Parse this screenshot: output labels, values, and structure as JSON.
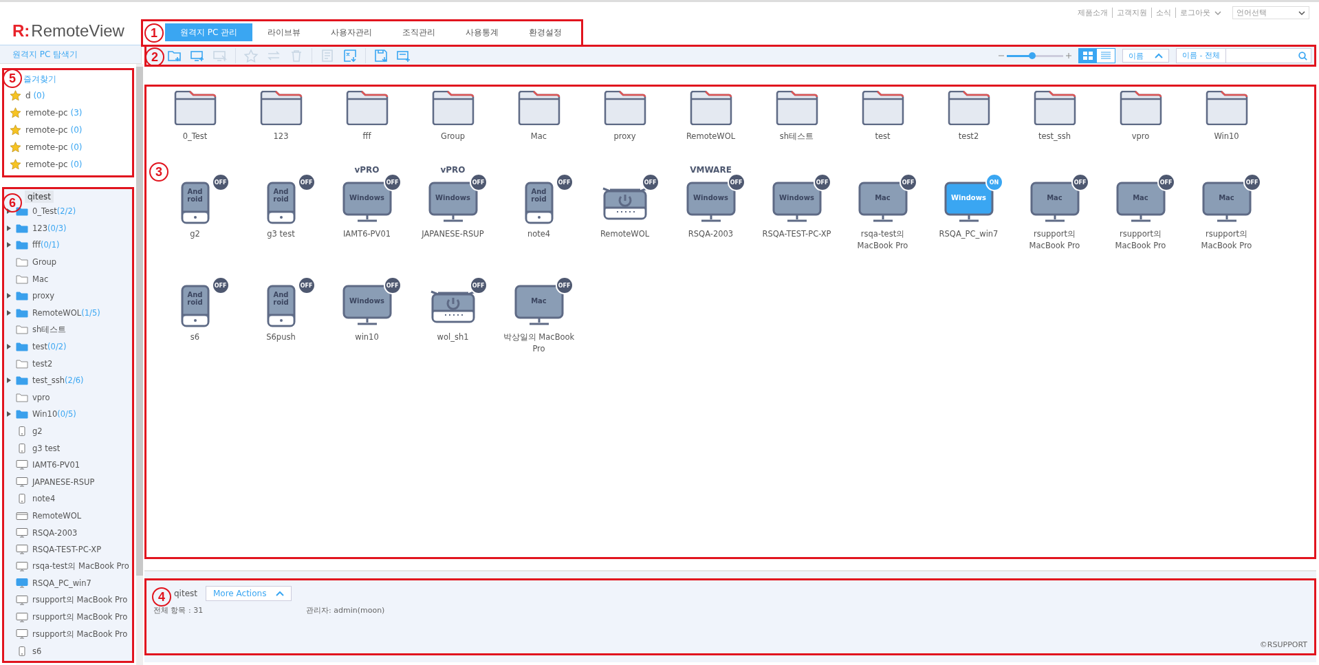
{
  "top_links": [
    "제품소개",
    "고객지원",
    "소식",
    "로그아웃"
  ],
  "language_select": {
    "value": "언어선택"
  },
  "logo": {
    "mark": "R:",
    "name": "RemoteView"
  },
  "tabs": {
    "callout": "1",
    "items": [
      {
        "label": "원격지 PC 관리",
        "selected": true
      },
      {
        "label": "라이브뷰",
        "selected": false
      },
      {
        "label": "사용자관리",
        "selected": false
      },
      {
        "label": "조직관리",
        "selected": false
      },
      {
        "label": "사용통계",
        "selected": false
      },
      {
        "label": "환경설정",
        "selected": false
      }
    ]
  },
  "toolbar": {
    "callout": "2",
    "tools": [
      {
        "kind": "folder-add",
        "disabled": false
      },
      {
        "kind": "monitor-add",
        "disabled": false
      },
      {
        "kind": "monitor-select",
        "disabled": true
      },
      {
        "kind": "star",
        "disabled": true
      },
      {
        "kind": "swap",
        "disabled": true
      },
      {
        "kind": "trash",
        "disabled": true
      },
      {
        "kind": "note",
        "disabled": true
      },
      {
        "kind": "excel",
        "disabled": false
      },
      {
        "kind": "save",
        "disabled": false
      },
      {
        "kind": "wol-add",
        "disabled": false
      }
    ],
    "zoom": {
      "level": 0.45
    },
    "views": [
      {
        "kind": "grid",
        "selected": true
      },
      {
        "kind": "list",
        "selected": false
      }
    ],
    "sort": {
      "label": "이름"
    },
    "search": {
      "scope": "이름 - 전체"
    }
  },
  "sidebar": {
    "title": "원격지 PC 탐색기",
    "favorites": {
      "callout": "5",
      "title": "즐겨찾기",
      "items": [
        {
          "name": "d",
          "count": "(0)"
        },
        {
          "name": "remote-pc",
          "count": "(3)"
        },
        {
          "name": "remote-pc",
          "count": "(0)"
        },
        {
          "name": "remote-pc",
          "count": "(0)"
        },
        {
          "name": "remote-pc",
          "count": "(0)"
        }
      ]
    },
    "tree": {
      "callout": "6",
      "root": "qitest",
      "children": [
        {
          "kind": "group",
          "has_children": true,
          "name": "0_Test",
          "count": "(2/2)"
        },
        {
          "kind": "group",
          "has_children": true,
          "name": "123",
          "count": "(0/3)"
        },
        {
          "kind": "group",
          "has_children": true,
          "name": "fff",
          "count": "(0/1)"
        },
        {
          "kind": "group",
          "has_children": false,
          "name": "Group"
        },
        {
          "kind": "group",
          "has_children": false,
          "name": "Mac"
        },
        {
          "kind": "group",
          "has_children": true,
          "name": "proxy"
        },
        {
          "kind": "group",
          "has_children": true,
          "name": "RemoteWOL",
          "count": "(1/5)"
        },
        {
          "kind": "group",
          "has_children": false,
          "name": "sh테스트"
        },
        {
          "kind": "group",
          "has_children": true,
          "name": "test",
          "count": "(0/2)"
        },
        {
          "kind": "group",
          "has_children": false,
          "name": "test2"
        },
        {
          "kind": "group",
          "has_children": true,
          "name": "test_ssh",
          "count": "(2/6)"
        },
        {
          "kind": "group",
          "has_children": false,
          "name": "vpro"
        },
        {
          "kind": "group",
          "has_children": true,
          "name": "Win10",
          "count": "(0/5)"
        },
        {
          "kind": "android",
          "name": "g2"
        },
        {
          "kind": "android",
          "name": "g3 test"
        },
        {
          "kind": "monitor",
          "online": false,
          "name": "IAMT6-PV01"
        },
        {
          "kind": "monitor",
          "online": false,
          "name": "JAPANESE-RSUP"
        },
        {
          "kind": "android",
          "name": "note4"
        },
        {
          "kind": "wol",
          "name": "RemoteWOL"
        },
        {
          "kind": "monitor",
          "online": false,
          "name": "RSQA-2003"
        },
        {
          "kind": "monitor",
          "online": false,
          "name": "RSQA-TEST-PC-XP"
        },
        {
          "kind": "monitor",
          "online": false,
          "name": "rsqa-test의 MacBook Pro"
        },
        {
          "kind": "monitor",
          "online": true,
          "name": "RSQA_PC_win7"
        },
        {
          "kind": "monitor",
          "online": false,
          "name": "rsupport의 MacBook Pro"
        },
        {
          "kind": "monitor",
          "online": false,
          "name": "rsupport의 MacBook Pro"
        },
        {
          "kind": "monitor",
          "online": false,
          "name": "rsupport의 MacBook Pro"
        },
        {
          "kind": "android",
          "name": "s6"
        }
      ]
    }
  },
  "content": {
    "callout": "3",
    "folders": [
      "0_Test",
      "123",
      "fff",
      "Group",
      "Mac",
      "proxy",
      "RemoteWOL",
      "sh테스트",
      "test",
      "test2",
      "test_ssh",
      "vpro",
      "Win10"
    ],
    "devices": [
      {
        "kind": "android",
        "os_label": "And roid",
        "status": "OFF",
        "online": false,
        "name": "g2"
      },
      {
        "kind": "android",
        "os_label": "And roid",
        "status": "OFF",
        "online": false,
        "name": "g3 test"
      },
      {
        "kind": "monitor",
        "badge": "vPRO",
        "os_label": "Windows",
        "status": "OFF",
        "online": false,
        "name": "IAMT6-PV01"
      },
      {
        "kind": "monitor",
        "badge": "vPRO",
        "os_label": "Windows",
        "status": "OFF",
        "online": false,
        "name": "JAPANESE-RSUP"
      },
      {
        "kind": "android",
        "os_label": "And roid",
        "status": "OFF",
        "online": false,
        "name": "note4"
      },
      {
        "kind": "wol",
        "status": "OFF",
        "online": false,
        "name": "RemoteWOL"
      },
      {
        "kind": "monitor",
        "badge": "VMWARE",
        "os_label": "Windows",
        "status": "OFF",
        "online": false,
        "name": "RSQA-2003"
      },
      {
        "kind": "monitor",
        "os_label": "Windows",
        "status": "OFF",
        "online": false,
        "name": "RSQA-TEST-PC-XP"
      },
      {
        "kind": "monitor",
        "os_label": "Mac",
        "status": "OFF",
        "online": false,
        "name": "rsqa-test의 MacBook Pro"
      },
      {
        "kind": "monitor",
        "os_label": "Windows",
        "status": "ON",
        "online": true,
        "name": "RSQA_PC_win7"
      },
      {
        "kind": "monitor",
        "os_label": "Mac",
        "status": "OFF",
        "online": false,
        "name": "rsupport의 MacBook Pro"
      },
      {
        "kind": "monitor",
        "os_label": "Mac",
        "status": "OFF",
        "online": false,
        "name": "rsupport의 MacBook Pro"
      },
      {
        "kind": "monitor",
        "os_label": "Mac",
        "status": "OFF",
        "online": false,
        "name": "rsupport의 MacBook Pro"
      },
      {
        "kind": "android",
        "os_label": "And roid",
        "status": "OFF",
        "online": false,
        "name": "s6"
      },
      {
        "kind": "android",
        "os_label": "And roid",
        "status": "OFF",
        "online": false,
        "name": "S6push"
      },
      {
        "kind": "monitor",
        "os_label": "Windows",
        "status": "OFF",
        "online": false,
        "name": "win10"
      },
      {
        "kind": "wol",
        "status": "OFF",
        "online": false,
        "name": "wol_sh1"
      },
      {
        "kind": "monitor",
        "os_label": "Mac",
        "status": "OFF",
        "online": false,
        "name": "박상일의 MacBook Pro"
      }
    ]
  },
  "footer": {
    "callout": "4",
    "group": "qitest",
    "more_actions": "More Actions",
    "total": "전체 항목 : 31",
    "admin": "관리자: admin(moon)",
    "copyright": "©RSUPPORT"
  }
}
